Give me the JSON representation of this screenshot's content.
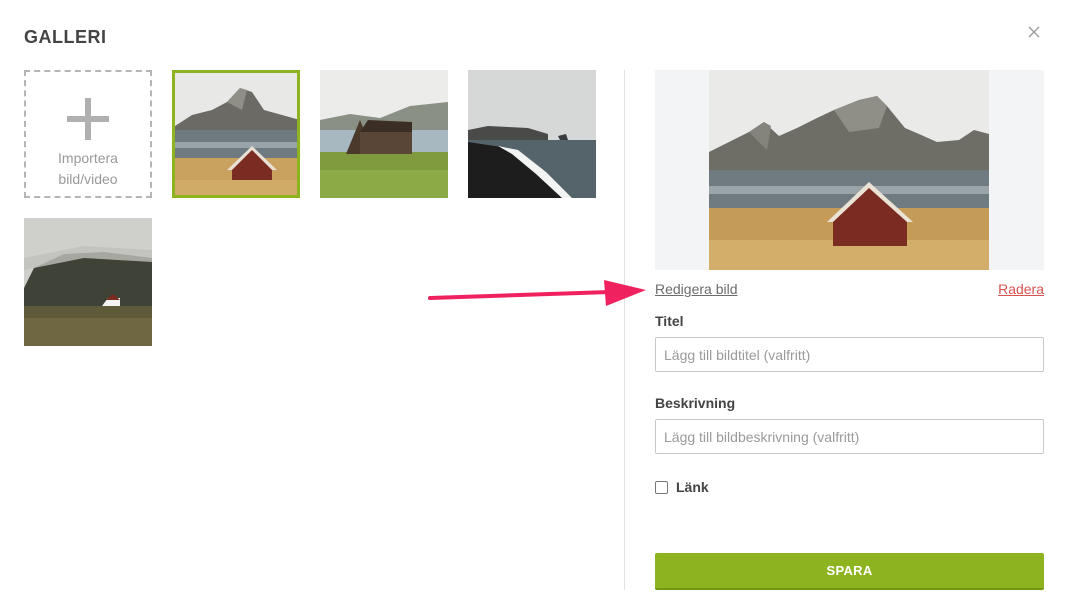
{
  "dialog": {
    "title": "GALLERI"
  },
  "gallery": {
    "import_label_line1": "Importera",
    "import_label_line2": "bild/video",
    "items": [
      {
        "name": "mountain-red-cabin",
        "selected": true
      },
      {
        "name": "a-frame-cabin",
        "selected": false
      },
      {
        "name": "black-sand-beach",
        "selected": false
      },
      {
        "name": "misty-hill-house",
        "selected": false
      }
    ]
  },
  "details": {
    "edit_link": "Redigera bild",
    "delete_link": "Radera",
    "title_label": "Titel",
    "title_placeholder": "Lägg till bildtitel (valfritt)",
    "title_value": "",
    "description_label": "Beskrivning",
    "description_placeholder": "Lägg till bildbeskrivning (valfritt)",
    "description_value": "",
    "link_label": "Länk",
    "link_checked": false,
    "save_label": "SPARA"
  },
  "colors": {
    "accent": "#8db41e",
    "danger": "#d9534f",
    "arrow": "#f0215f"
  }
}
